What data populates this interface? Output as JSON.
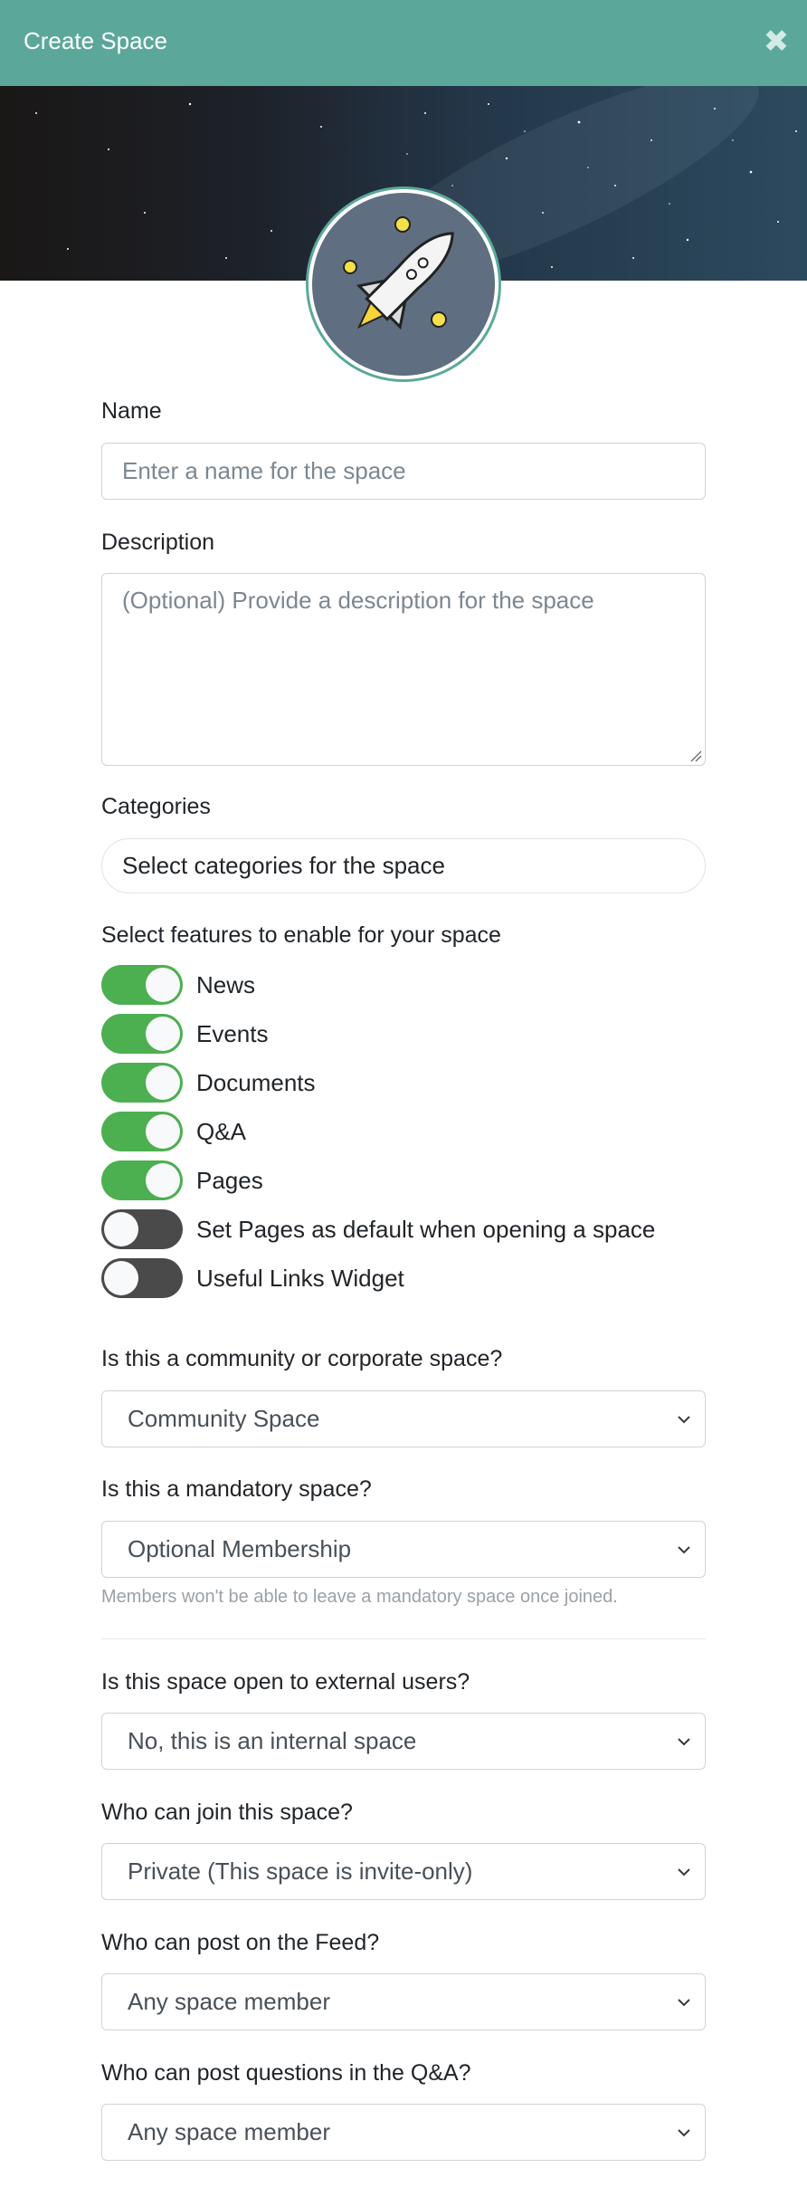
{
  "header": {
    "title": "Create Space",
    "close_icon": "close-icon"
  },
  "banner": {
    "image": "starfield-banner",
    "avatar_icon": "rocket-icon"
  },
  "name": {
    "label": "Name",
    "placeholder": "Enter a name for the space"
  },
  "description": {
    "label": "Description",
    "placeholder": "(Optional) Provide a description for the space"
  },
  "categories": {
    "label": "Categories",
    "placeholder": "Select categories for the space"
  },
  "features": {
    "label": "Select features to enable for your space",
    "items": [
      {
        "label": "News",
        "enabled": true
      },
      {
        "label": "Events",
        "enabled": true
      },
      {
        "label": "Documents",
        "enabled": true
      },
      {
        "label": "Q&A",
        "enabled": true
      },
      {
        "label": "Pages",
        "enabled": true
      },
      {
        "label": "Set Pages as default when opening a space",
        "enabled": false
      },
      {
        "label": "Useful Links Widget",
        "enabled": false
      }
    ]
  },
  "space_type": {
    "label": "Is this a community or corporate space?",
    "value": "Community Space"
  },
  "mandatory": {
    "label": "Is this a mandatory space?",
    "value": "Optional Membership",
    "help": "Members won't be able to leave a mandatory space once joined."
  },
  "external": {
    "label": "Is this space open to external users?",
    "value": "No, this is an internal space"
  },
  "join": {
    "label": "Who can join this space?",
    "value": "Private (This space is invite-only)"
  },
  "feed_post": {
    "label": "Who can post on the Feed?",
    "value": "Any space member"
  },
  "qa_post": {
    "label": "Who can post questions in the Q&A?",
    "value": "Any space member"
  },
  "colors": {
    "header": "#5ba89b",
    "toggle_on": "#4caf50",
    "toggle_off": "#4a4a4a",
    "avatar_bg": "#5f6f81"
  }
}
